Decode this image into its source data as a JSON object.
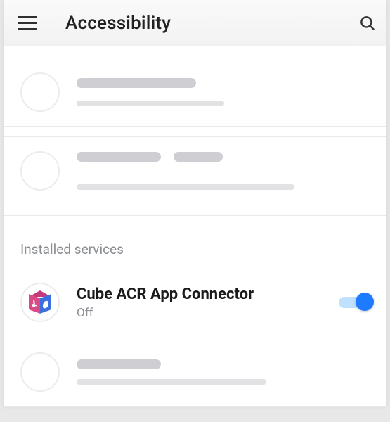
{
  "header": {
    "title": "Accessibility"
  },
  "section": {
    "installed_label": "Installed services"
  },
  "app": {
    "name": "Cube ACR App Connector",
    "status": "Off",
    "toggle_on": true
  },
  "icons": {
    "menu": "menu-icon",
    "search": "search-icon",
    "app": "cube-acr-icon"
  }
}
